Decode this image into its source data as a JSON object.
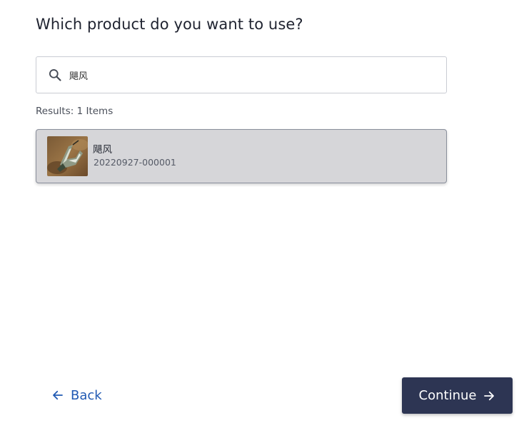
{
  "page": {
    "title": "Which product do you want to use?"
  },
  "search": {
    "value": "飓风",
    "icon": "search-icon"
  },
  "results": {
    "count_text": "Results: 1 Items",
    "items": [
      {
        "name": "飓风",
        "code": "20220927-000001",
        "selected": true
      }
    ]
  },
  "footer": {
    "back_label": "Back",
    "back_icon": "arrow-left-icon",
    "continue_label": "Continue",
    "continue_icon": "arrow-right-icon"
  },
  "colors": {
    "accent": "#2059b3",
    "primary_button": "#2d3553",
    "selected_item_bg": "#d6d6d9"
  }
}
